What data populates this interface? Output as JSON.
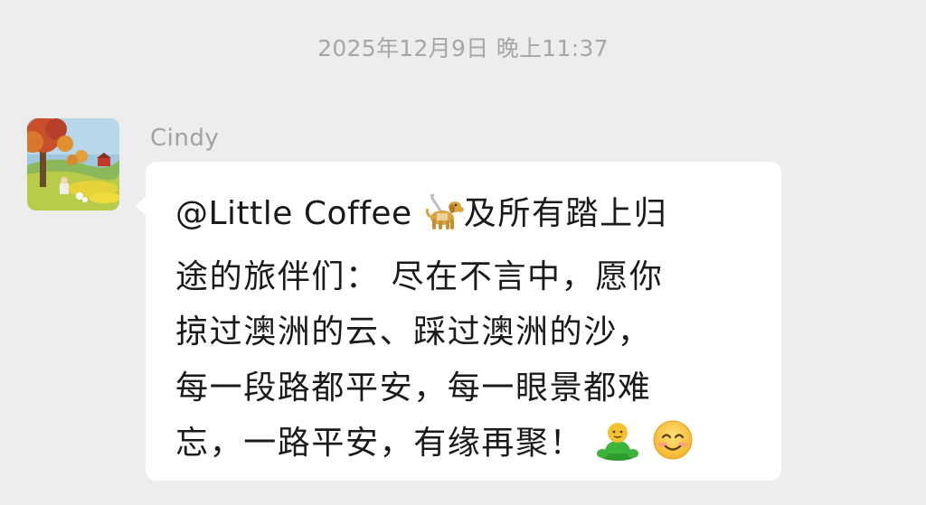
{
  "chat": {
    "timestamp": "2025年12月9日 晚上11:37",
    "message": {
      "sender": "Cindy",
      "avatar_icon": "autumn-landscape-avatar-icon",
      "mention": "@Little Coffee",
      "emoji_after_mention": "guide-dog-icon",
      "line1_rest": "及所有踏上归",
      "line2": "途的旅伴们： 尽在不言中，愿你",
      "line3": "掠过澳洲的云、踩过澳洲的沙，",
      "line4": "每一段路都平安，每一眼景都难",
      "line5_text": "忘，一路平安，有缘再聚！",
      "trailing_emojis": [
        "green-person-sticker-icon",
        "smiling-face-icon"
      ],
      "bubble_color": "#ffffff"
    },
    "background_color": "#ededed"
  }
}
